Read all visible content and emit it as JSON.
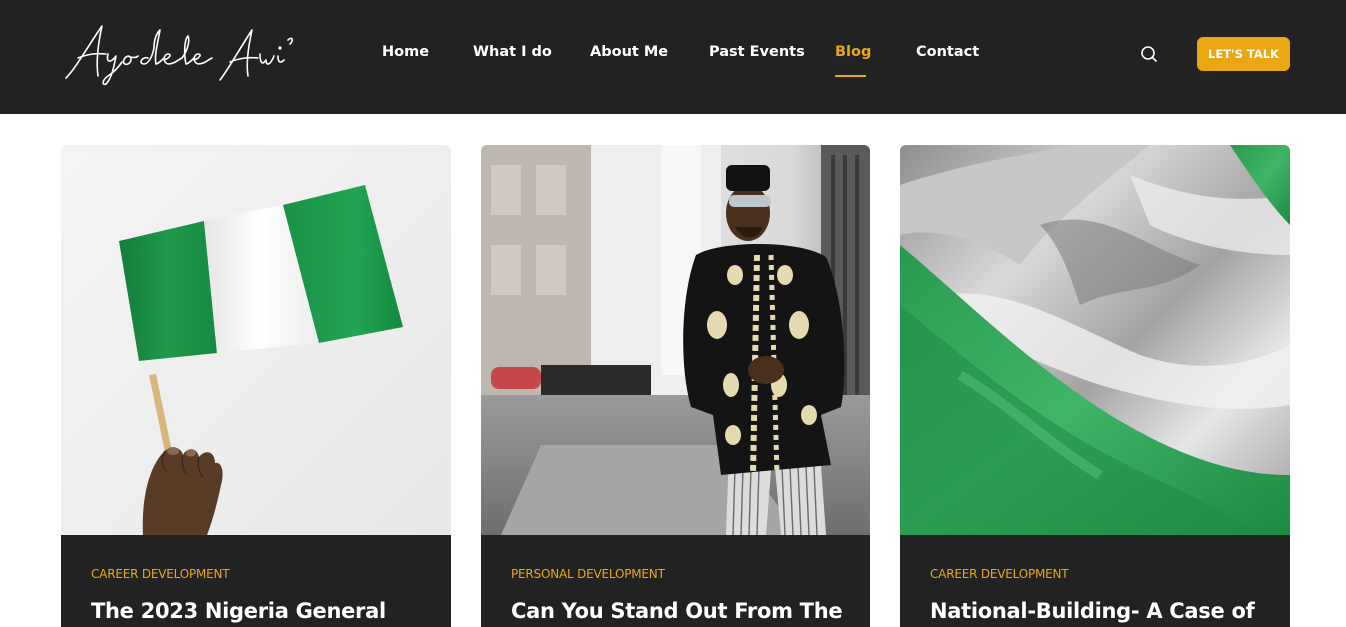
{
  "header": {
    "logo_text": "Ayodele Awi",
    "nav": [
      {
        "label": "Home"
      },
      {
        "label": "What I do"
      },
      {
        "label": "About Me"
      },
      {
        "label": "Past Events"
      },
      {
        "label": "Blog",
        "active": true
      },
      {
        "label": "Contact"
      }
    ],
    "search_icon": "search-icon",
    "cta_label": "LET'S TALK"
  },
  "posts": [
    {
      "category": "CAREER DEVELOPMENT",
      "title": "The 2023 Nigeria General",
      "image": "hand-holding-nigerian-flag"
    },
    {
      "category": "PERSONAL DEVELOPMENT",
      "title": "Can You Stand Out From The",
      "image": "man-in-embroidered-black-outfit"
    },
    {
      "category": "CAREER DEVELOPMENT",
      "title": "National-Building- A Case of",
      "image": "waving-nigerian-flag-closeup"
    }
  ],
  "colors": {
    "header_bg": "#222222",
    "accent": "#eaa712",
    "nigeria_green": "#1f9a4a"
  }
}
